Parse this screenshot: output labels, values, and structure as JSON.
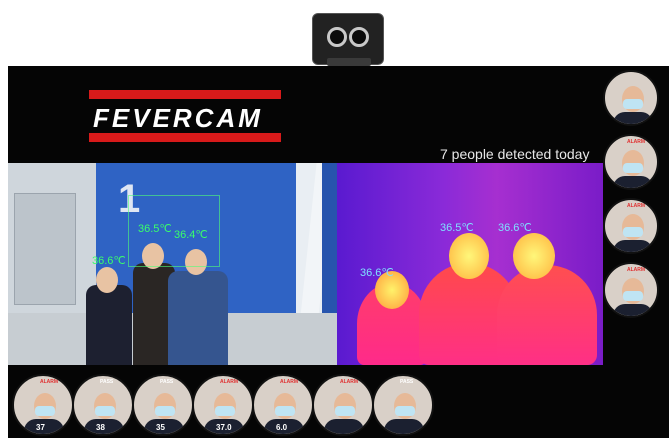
{
  "device": {
    "name": "FEVERCAM"
  },
  "header": {
    "brand": "FEVERCAM",
    "status": "7 people detected today"
  },
  "visual_feed": {
    "tags": [
      "36.6℃",
      "36.5℃",
      "36.4℃"
    ]
  },
  "thermal_feed": {
    "tags": [
      "36.5℃",
      "36.6℃",
      "36.6℃"
    ]
  },
  "side_list": {
    "items": [
      {
        "tag": "",
        "tag_color": "#e03030"
      },
      {
        "tag": "ALARM",
        "tag_color": "#e03030"
      },
      {
        "tag": "ALARM",
        "tag_color": "#e03030"
      },
      {
        "tag": "ALARM",
        "tag_color": "#e03030"
      }
    ]
  },
  "bottom_list": {
    "items": [
      {
        "tag": "ALARM",
        "tag_color": "#e03030",
        "temp": "37"
      },
      {
        "tag": "PASS",
        "tag_color": "#ffffff",
        "temp": "38"
      },
      {
        "tag": "PASS",
        "tag_color": "#ffffff",
        "temp": "35"
      },
      {
        "tag": "ALARM",
        "tag_color": "#e03030",
        "temp": "37.0"
      },
      {
        "tag": "ALARM",
        "tag_color": "#e03030",
        "temp": "6.0"
      },
      {
        "tag": "ALARM",
        "tag_color": "#e03030",
        "temp": ""
      },
      {
        "tag": "PASS",
        "tag_color": "#ffffff",
        "temp": ""
      }
    ]
  }
}
